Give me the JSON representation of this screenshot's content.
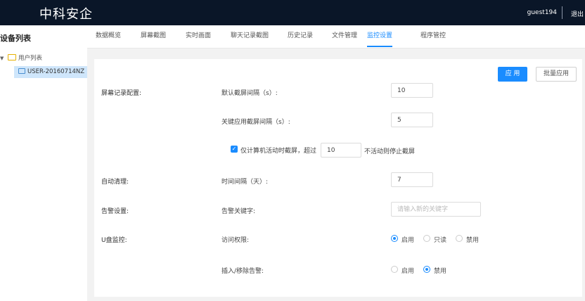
{
  "header": {
    "brand": "中科安企",
    "username": "guest194",
    "logout": "退出"
  },
  "sidebar": {
    "title": "设备列表",
    "tree_root": "用户列表",
    "tree_node": "USER-20160714NZ"
  },
  "tabs": [
    {
      "label": "数据概览"
    },
    {
      "label": "屏幕截图"
    },
    {
      "label": "实时画面"
    },
    {
      "label": "聊天记录截图"
    },
    {
      "label": "历史记录"
    },
    {
      "label": "文件管理"
    },
    {
      "label": "监控设置",
      "active": true
    },
    {
      "label": "程序管控"
    }
  ],
  "actions": {
    "apply": "应 用",
    "batch_apply": "批量应用"
  },
  "screen_record": {
    "section_label": "屏幕记录配置:",
    "default_interval_label": "默认截屏间隔（s）:",
    "default_interval_value": "10",
    "key_interval_label": "关键应用截屏间隔（s）:",
    "key_interval_value": "5",
    "only_active_label": "仅计算机活动时截屏，超过",
    "only_active_checked": true,
    "inactive_minutes_value": "10",
    "inactive_suffix": "不活动则停止截屏"
  },
  "auto_clean": {
    "section_label": "自动清理:",
    "interval_label": "时间间隔（天）:",
    "interval_value": "7"
  },
  "alert": {
    "section_label": "告警设置:",
    "keyword_label": "告警关键字:",
    "keyword_placeholder": "请输入新的关键字",
    "keyword_value": ""
  },
  "usb": {
    "section_label": "U盘监控:",
    "access_label": "访问权限:",
    "access_options": [
      {
        "label": "启用",
        "selected": true
      },
      {
        "label": "只读",
        "selected": false
      },
      {
        "label": "禁用",
        "selected": false
      }
    ],
    "plug_alert_label": "插入/移除告警:",
    "plug_alert_options": [
      {
        "label": "启用",
        "selected": false
      },
      {
        "label": "禁用",
        "selected": true
      }
    ]
  }
}
